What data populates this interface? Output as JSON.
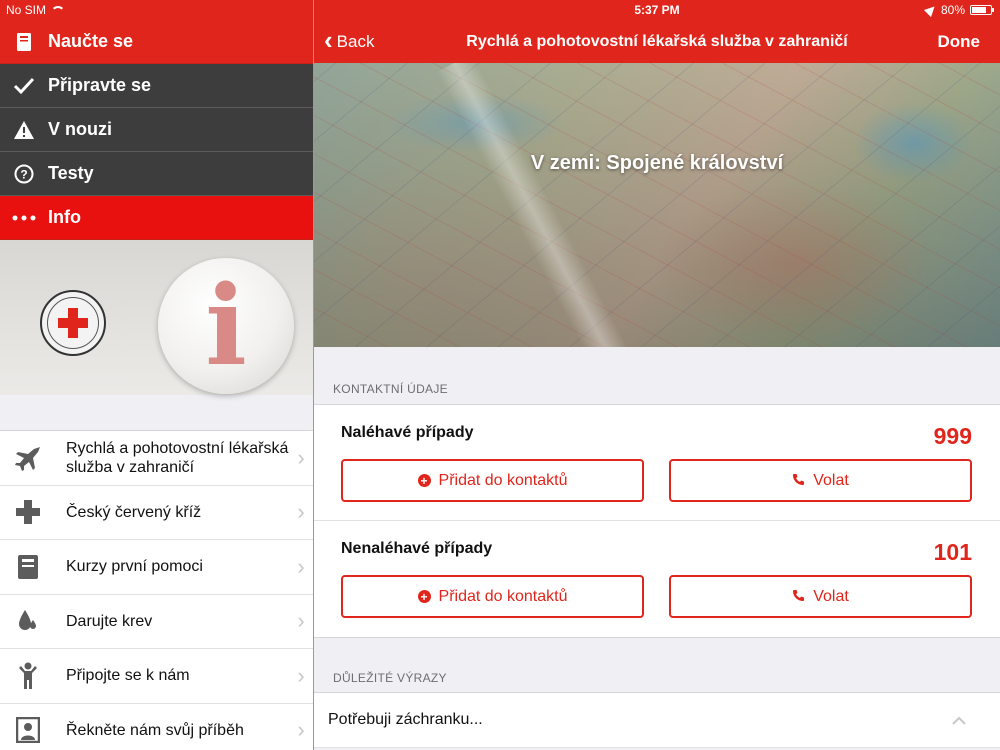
{
  "left": {
    "status": {
      "carrier": "No SIM"
    },
    "menu": [
      {
        "label": "Naučte se",
        "icon": "book-icon",
        "style": "red"
      },
      {
        "label": "Připravte se",
        "icon": "checkmark-icon",
        "style": "dark"
      },
      {
        "label": "V nouzi",
        "icon": "warning-icon",
        "style": "dark"
      },
      {
        "label": "Testy",
        "icon": "question-icon",
        "style": "dark"
      },
      {
        "label": "Info",
        "icon": "more-dots-icon",
        "style": "active"
      }
    ],
    "banner": {
      "logo_text": "ČESKÝ ČERVENÝ KŘÍŽ",
      "info_glyph": "i"
    },
    "list": [
      {
        "label": "Rychlá a pohotovostní lékařská služba v zahraničí",
        "icon": "airplane-icon"
      },
      {
        "label": "Český červený kříž",
        "icon": "cross-icon"
      },
      {
        "label": "Kurzy první pomoci",
        "icon": "book-icon"
      },
      {
        "label": "Darujte krev",
        "icon": "blood-drop-icon"
      },
      {
        "label": "Připojte se k nám",
        "icon": "person-icon"
      },
      {
        "label": "Řekněte nám svůj příběh",
        "icon": "portrait-icon"
      }
    ]
  },
  "right": {
    "status": {
      "time": "5:37 PM",
      "battery": "80%",
      "battery_level": 0.8
    },
    "nav": {
      "back": "Back",
      "title": "Rychlá a pohotovostní lékařská služba v zahraničí",
      "done": "Done"
    },
    "hero": {
      "title": "V zemi: Spojené království"
    },
    "contacts_header": "KONTAKTNÍ ÚDAJE",
    "contacts": [
      {
        "label": "Naléhavé případy",
        "number": "999",
        "add_label": "Přidat do kontaktů",
        "call_label": "Volat"
      },
      {
        "label": "Nenaléhavé případy",
        "number": "101",
        "add_label": "Přidat do kontaktů",
        "call_label": "Volat"
      }
    ],
    "phrases_header": "DŮLEŽITÉ VÝRAZY",
    "phrases": [
      {
        "label": "Potřebuji záchranku..."
      }
    ]
  },
  "colors": {
    "brand_red": "#e0261c",
    "menu_dark": "#3d3d3d",
    "background": "#efeff4"
  }
}
